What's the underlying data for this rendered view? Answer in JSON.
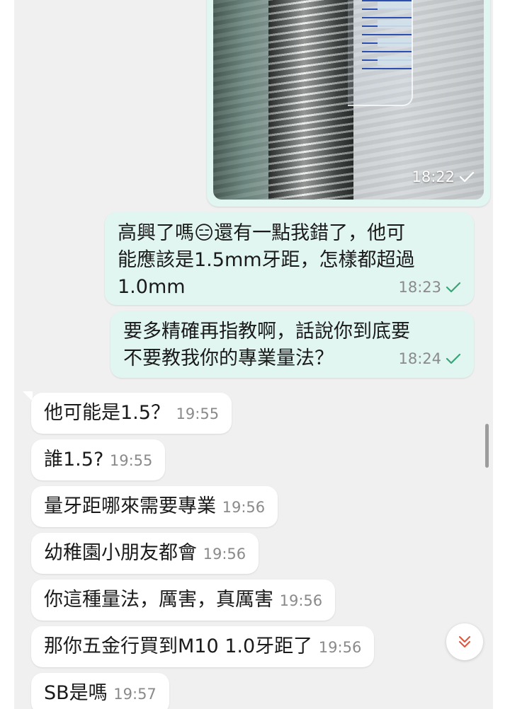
{
  "photo_message": {
    "time": "18:22"
  },
  "outgoing": [
    {
      "lines": [
        "高興了嗎😑還有一點我錯了，他可",
        "能應該是1.5mm牙距，怎樣都超過",
        "1.0mm"
      ],
      "time": "18:23"
    },
    {
      "lines": [
        "要多精確再指教啊，話說你到底要",
        "不要教我你的專業量法？"
      ],
      "time": "18:24"
    }
  ],
  "incoming": [
    {
      "text": "他可能是1.5？",
      "time": "19:55"
    },
    {
      "text": "誰1.5?",
      "time": "19:55"
    },
    {
      "text": "量牙距哪來需要專業",
      "time": "19:56"
    },
    {
      "text": "幼稚園小朋友都會",
      "time": "19:56"
    },
    {
      "text": "你這種量法，厲害，真厲害",
      "time": "19:56"
    },
    {
      "text": "那你五金行買到M10 1.0牙距了",
      "time": "19:56"
    },
    {
      "text": "SB是嗎",
      "time": "19:57"
    }
  ],
  "icons": {
    "read_check": "check-icon",
    "scroll_down": "chevron-double-down-icon"
  },
  "colors": {
    "outgoing_bubble": "#e2f6f1",
    "incoming_bubble": "#ffffff",
    "chat_background": "#f0f0f0",
    "check_sent": "#3aa37a",
    "scroll_arrow": "#e2533a"
  }
}
